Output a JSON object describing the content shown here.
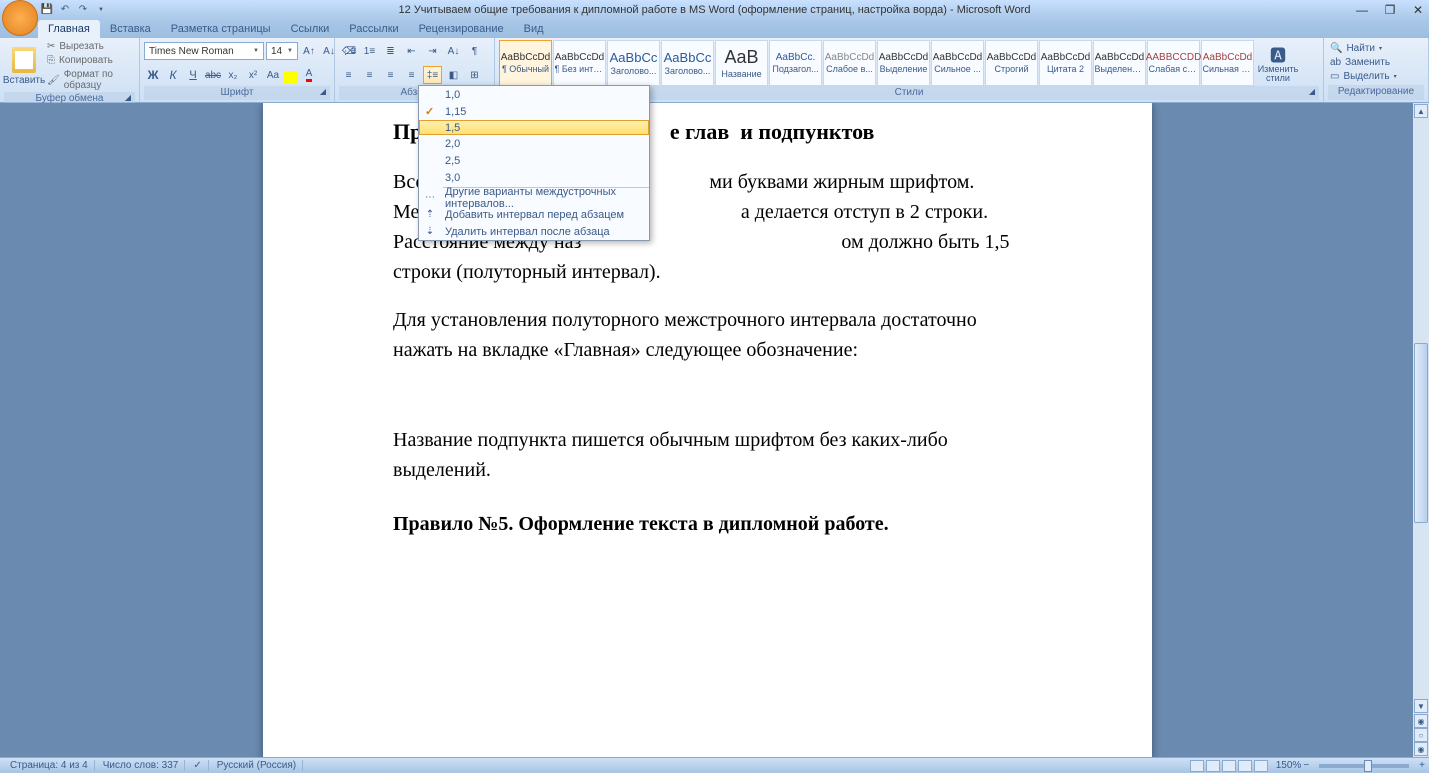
{
  "title": "12 Учитываем общие требования к дипломной работе в MS Word (оформление страниц, настройка ворда) - Microsoft Word",
  "tabs": {
    "home": "Главная",
    "insert": "Вставка",
    "page_layout": "Разметка страницы",
    "references": "Ссылки",
    "mailings": "Рассылки",
    "review": "Рецензирование",
    "view": "Вид"
  },
  "clipboard": {
    "paste": "Вставить",
    "cut": "Вырезать",
    "copy": "Копировать",
    "format_painter": "Формат по образцу",
    "group_label": "Буфер обмена"
  },
  "font": {
    "name": "Times New Roman",
    "size": "14",
    "group_label": "Шрифт"
  },
  "paragraph": {
    "group_label": "Абзац"
  },
  "styles": {
    "group_label": "Стили",
    "change_styles": "Изменить стили",
    "items": [
      {
        "preview": "AaBbCcDd",
        "name": "¶ Обычный",
        "color": "#333"
      },
      {
        "preview": "AaBbCcDd",
        "name": "¶ Без инте...",
        "color": "#333"
      },
      {
        "preview": "AaBbCc",
        "name": "Заголово...",
        "color": "#2a5a9a"
      },
      {
        "preview": "AaBbCc",
        "name": "Заголово...",
        "color": "#2a5a9a"
      },
      {
        "preview": "AaB",
        "name": "Название",
        "color": "#333"
      },
      {
        "preview": "AaBbCc.",
        "name": "Подзагол...",
        "color": "#2a5a9a"
      },
      {
        "preview": "AaBbCcDd",
        "name": "Слабое в...",
        "color": "#888"
      },
      {
        "preview": "AaBbCcDd",
        "name": "Выделение",
        "color": "#333"
      },
      {
        "preview": "AaBbCcDd",
        "name": "Сильное ...",
        "color": "#333"
      },
      {
        "preview": "AaBbCcDd",
        "name": "Строгий",
        "color": "#333"
      },
      {
        "preview": "AaBbCcDd",
        "name": "Цитата 2",
        "color": "#333"
      },
      {
        "preview": "AaBbCcDd",
        "name": "Выделенн...",
        "color": "#333"
      },
      {
        "preview": "AABBCCDD",
        "name": "Слабая сс...",
        "color": "#a04040"
      },
      {
        "preview": "AaBbCcDd",
        "name": "Сильная с...",
        "color": "#a04040"
      }
    ]
  },
  "editing": {
    "group_label": "Редактирование",
    "find": "Найти",
    "replace": "Заменить",
    "select": "Выделить"
  },
  "line_spacing": {
    "options": [
      "1,0",
      "1,15",
      "1,5",
      "2,0",
      "2,5",
      "3,0"
    ],
    "checked_index": 1,
    "hover_index": 2,
    "more_options": "Другие варианты междустрочных интервалов...",
    "add_before": "Добавить интервал перед абзацем",
    "remove_after": "Удалить интервал после абзаца"
  },
  "document": {
    "heading_partial": "Пр                                             е глав  и подпунктов",
    "p1": "Все                                                         ми буквами жирным шрифтом. Между наз                                                   а делается отступ в 2 строки. Расстояние между наз                                                    ом должно быть 1,5 строки (полуторный интервал).",
    "p2": "Для установления полуторного межстрочного интервала достаточно нажать на вкладке «Главная» следующее обозначение:",
    "p3": "Название подпункта пишется обычным шрифтом без каких-либо выделений.",
    "h3": "Правило №5. Оформление текста в дипломной работе."
  },
  "status": {
    "page": "Страница: 4 из 4",
    "words": "Число слов: 337",
    "language": "Русский (Россия)",
    "zoom": "150%"
  }
}
